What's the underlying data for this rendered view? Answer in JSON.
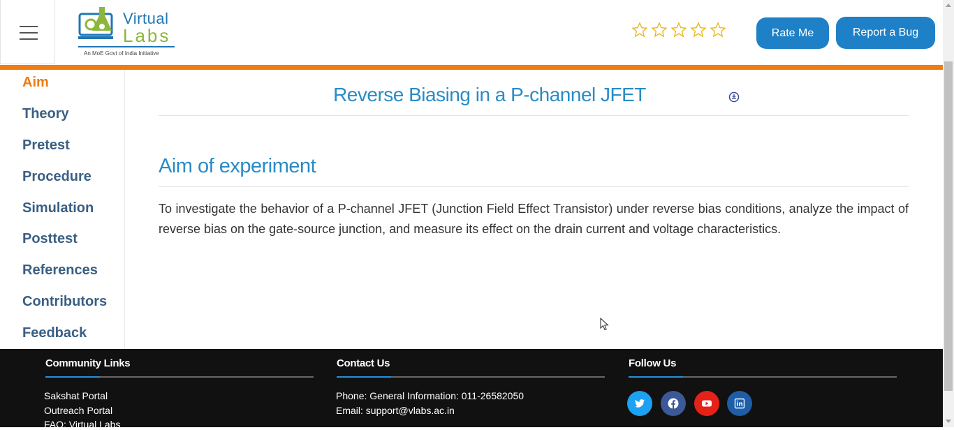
{
  "header": {
    "logo": {
      "line1": "Virtual",
      "line2": "Labs",
      "tagline": "An MoE Govt of India Initiative"
    },
    "rating": {
      "stars": 5,
      "filled": 0
    },
    "rate_label": "Rate Me",
    "bug_label": "Report a Bug"
  },
  "colors": {
    "accent": "#f07b13",
    "primary": "#2a8bc6",
    "button": "#1e80c6",
    "footer_bg": "#111111"
  },
  "sidebar": {
    "items": [
      {
        "label": "Aim",
        "active": true
      },
      {
        "label": "Theory"
      },
      {
        "label": "Pretest"
      },
      {
        "label": "Procedure"
      },
      {
        "label": "Simulation"
      },
      {
        "label": "Posttest"
      },
      {
        "label": "References"
      },
      {
        "label": "Contributors"
      },
      {
        "label": "Feedback"
      }
    ]
  },
  "main": {
    "title": "Reverse Biasing in a P-channel JFET",
    "section_title": "Aim of experiment",
    "aim_text": "To investigate the behavior of a P-channel JFET (Junction Field Effect Transistor) under reverse bias conditions, analyze the impact of reverse bias on the gate-source junction, and measure its effect on the drain current and voltage characteristics."
  },
  "footer": {
    "community": {
      "heading": "Community Links",
      "links": [
        "Sakshat Portal",
        "Outreach Portal",
        "FAQ: Virtual Labs"
      ]
    },
    "contact": {
      "heading": "Contact Us",
      "phone": "Phone: General Information: 011-26582050",
      "email": "Email: support@vlabs.ac.in"
    },
    "follow": {
      "heading": "Follow Us",
      "icons": [
        "twitter-icon",
        "facebook-icon",
        "youtube-icon",
        "linkedin-icon"
      ]
    }
  }
}
